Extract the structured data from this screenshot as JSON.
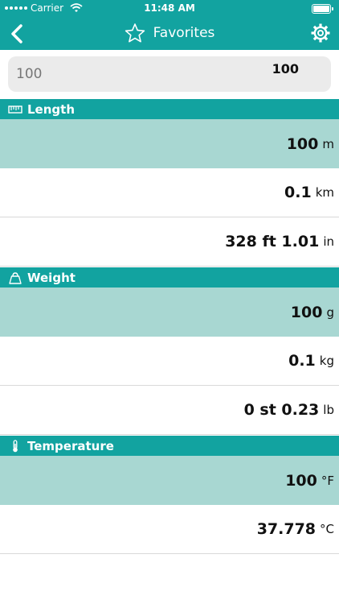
{
  "status_bar": {
    "carrier": "Carrier",
    "time": "11:48 AM"
  },
  "nav": {
    "title": "Favorites",
    "back_icon": "chevron-left-icon",
    "star_icon": "star-icon",
    "settings_icon": "gear-icon"
  },
  "search": {
    "input_value": "100",
    "result_value": "100"
  },
  "colors": {
    "accent": "#12a3a0",
    "selected_row": "#a8d7d2",
    "search_bg": "#ebebeb"
  },
  "sections": [
    {
      "title": "Length",
      "icon": "ruler-icon",
      "rows": [
        {
          "value": "100",
          "unit": "m",
          "selected": true
        },
        {
          "value": "0.1",
          "unit": "km",
          "selected": false
        },
        {
          "value": "328 ft 1.01",
          "unit": "in",
          "selected": false
        }
      ]
    },
    {
      "title": "Weight",
      "icon": "weight-icon",
      "rows": [
        {
          "value": "100",
          "unit": "g",
          "selected": true
        },
        {
          "value": "0.1",
          "unit": "kg",
          "selected": false
        },
        {
          "value": "0 st 0.23",
          "unit": "lb",
          "selected": false
        }
      ]
    },
    {
      "title": "Temperature",
      "icon": "thermometer-icon",
      "rows": [
        {
          "value": "100",
          "unit": "°F",
          "selected": true
        },
        {
          "value": "37.778",
          "unit": "°C",
          "selected": false
        }
      ]
    }
  ]
}
